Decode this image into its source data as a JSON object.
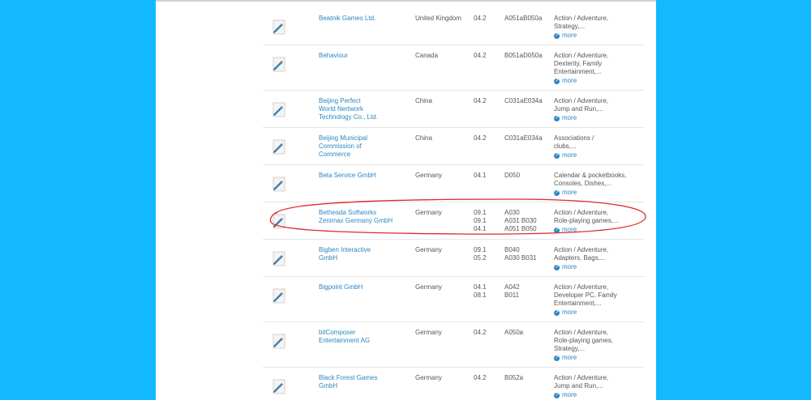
{
  "exhibitors": [
    {
      "name": [
        "Beatnik Games Ltd."
      ],
      "country": "United Kingdom",
      "halls": [
        "04.2"
      ],
      "stands": [
        "A051aB050a"
      ],
      "categories": [
        "Action / Adventure,",
        "Strategy,..."
      ]
    },
    {
      "name": [
        "Behaviour"
      ],
      "country": "Canada",
      "halls": [
        "04.2"
      ],
      "stands": [
        "B051aD050a"
      ],
      "categories": [
        "Action / Adventure,",
        "Dexterity, Family",
        "Entertainment,..."
      ]
    },
    {
      "name": [
        "Beijing Perfect",
        "World Nertwork",
        "Technology Co., Ltd."
      ],
      "country": "China",
      "halls": [
        "04.2"
      ],
      "stands": [
        "C031aE034a"
      ],
      "categories": [
        "Action / Adventure,",
        "Jump and Run,..."
      ]
    },
    {
      "name": [
        "Beijing Municipal",
        "Commission of",
        "Commerce"
      ],
      "country": "China",
      "halls": [
        "04.2"
      ],
      "stands": [
        "C031aE034a"
      ],
      "categories": [
        "Associations /",
        "clubs,..."
      ]
    },
    {
      "name": [
        "Beta Service GmbH"
      ],
      "country": "Germany",
      "halls": [
        "04.1"
      ],
      "stands": [
        "D050"
      ],
      "categories": [
        "Calendar & pocketbooks,",
        "Consoles, Dishes,..."
      ]
    },
    {
      "name": [
        "Bethesda Softworks",
        "Zenimax Germany GmbH"
      ],
      "country": "Germany",
      "halls": [
        "09.1",
        "09.1",
        "04.1"
      ],
      "stands": [
        "A030",
        "A031 B030",
        "A051 B050"
      ],
      "categories": [
        "Action / Adventure,",
        "Role-playing games,..."
      ]
    },
    {
      "name": [
        "Bigben Interactive",
        "GmbH"
      ],
      "country": "Germany",
      "halls": [
        "09.1",
        "05.2"
      ],
      "stands": [
        "B040",
        "A030 B031"
      ],
      "categories": [
        "Action / Adventure,",
        "Adapters, Bags,..."
      ]
    },
    {
      "name": [
        "Bigpoint GmbH"
      ],
      "country": "Germany",
      "halls": [
        "04.1",
        "08.1"
      ],
      "stands": [
        "A042",
        "B011"
      ],
      "categories": [
        "Action / Adventure,",
        "Developer PC, Family",
        "Entertainment,..."
      ]
    },
    {
      "name": [
        "bitComposer",
        "Entertainment AG"
      ],
      "country": "Germany",
      "halls": [
        "04.2"
      ],
      "stands": [
        "A050a"
      ],
      "categories": [
        "Action / Adventure,",
        "Role-playing games,",
        "Strategy,..."
      ]
    },
    {
      "name": [
        "Black Forest Games",
        "GmbH"
      ],
      "country": "Germany",
      "halls": [
        "04.2"
      ],
      "stands": [
        "B052a"
      ],
      "categories": [
        "Action / Adventure,",
        "Jump and Run,..."
      ]
    }
  ],
  "more_label": "more",
  "colors": {
    "background": "#13b9ff",
    "link": "#2b86c4",
    "highlight": "#e0282b"
  }
}
